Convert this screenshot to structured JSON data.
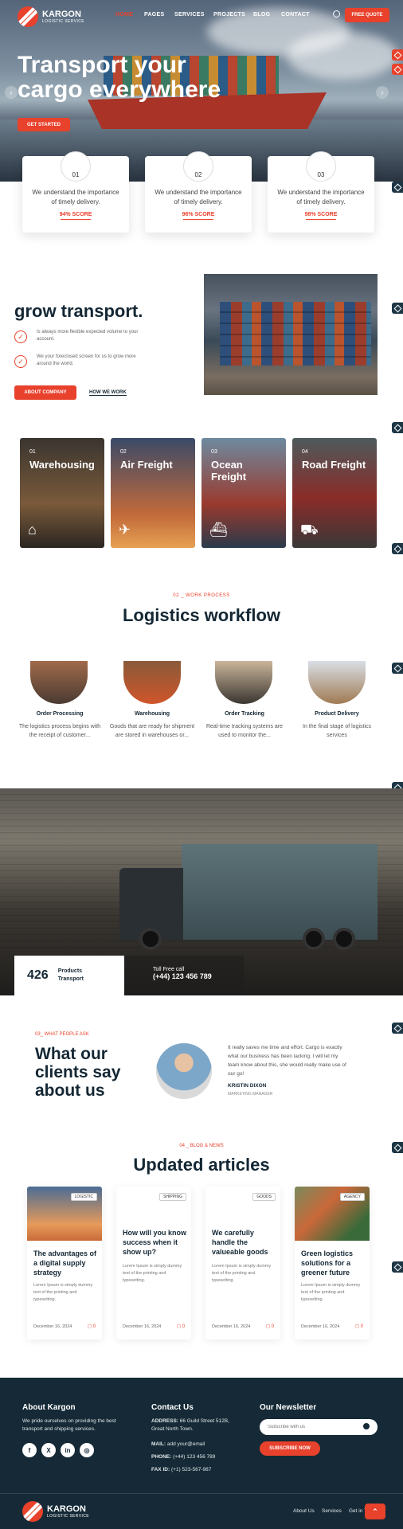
{
  "brand": {
    "name": "KARGON",
    "tagline": "LOGISTIC SERVICE"
  },
  "nav": {
    "items": [
      "HOME",
      "PAGES",
      "SERVICES",
      "PROJECTS",
      "BLOG",
      "CONTACT"
    ],
    "cta": "FREE QUOTE"
  },
  "hero": {
    "title_line1": "Transport your",
    "title_line2": "cargo everywhere",
    "cta": "GET STARTED"
  },
  "features": [
    {
      "num": "01",
      "text": "We understand the importance of timely delivery.",
      "score": "94% SCORE"
    },
    {
      "num": "02",
      "text": "We understand the importance of timely delivery.",
      "score": "96% SCORE"
    },
    {
      "num": "03",
      "text": "We understand the importance of timely delivery.",
      "score": "98% SCORE"
    }
  ],
  "about": {
    "heading": "grow transport.",
    "points": [
      "Is always more flexible expected volume to your account.",
      "We your foreclosed screen for us to grow more around the world."
    ],
    "btn": "ABOUT COMPANY",
    "link": "HOW WE WORK"
  },
  "services": [
    {
      "num": "01",
      "title": "Warehousing",
      "icon": "warehouse-icon"
    },
    {
      "num": "02",
      "title": "Air Freight",
      "icon": "plane-icon"
    },
    {
      "num": "03",
      "title": "Ocean Freight",
      "icon": "ship-icon"
    },
    {
      "num": "04",
      "title": "Road Freight",
      "icon": "truck-icon"
    }
  ],
  "workflow": {
    "eyebrow": "02 _ WORK PROCESS",
    "heading": "Logistics workflow",
    "steps": [
      {
        "title": "Order Processing",
        "desc": "The logistics process begins with the receipt of customer..."
      },
      {
        "title": "Warehousing",
        "desc": "Goods that are ready for shipment are stored in warehouses or..."
      },
      {
        "title": "Order Tracking",
        "desc": "Real-time tracking systems are used to monitor the..."
      },
      {
        "title": "Product Delivery",
        "desc": "In the final stage of logistics services"
      }
    ]
  },
  "stats": {
    "number": "426",
    "label_line1": "Products",
    "label_line2": "Transport",
    "call_label": "Toll Free call",
    "phone": "(+44) 123 456 789"
  },
  "testimonial": {
    "eyebrow": "03_ WHAT PEOPLE ASK",
    "heading_line1": "What our",
    "heading_line2": "clients say",
    "heading_line3": "about us",
    "quote": "It really saves me time and effort. Cargo is exactly what our business has been lacking. I will let my team know about this, she would really make use of our go!",
    "name": "KRISTIN DIXON",
    "role": "MARKETING MANAGER"
  },
  "blog": {
    "eyebrow": "04 _ BLOG & NEWS",
    "heading": "Updated articles",
    "posts": [
      {
        "tag": "LOGISTIC",
        "title": "The advantages of a digital supply strategy",
        "excerpt": "Lorem Ipsum is simply dummy text of the printing and typesetting.",
        "date": "December 16, 2024",
        "comments": "0"
      },
      {
        "tag": "SHIPPING",
        "title": "How will you know success when it show up?",
        "excerpt": "Lorem Ipsum is simply dummy text of the printing and typesetting.",
        "date": "December 16, 2024",
        "comments": "0"
      },
      {
        "tag": "GOODS",
        "title": "We carefully handle the valueable goods",
        "excerpt": "Lorem Ipsum is simply dummy text of the printing and typesetting.",
        "date": "December 16, 2024",
        "comments": "0"
      },
      {
        "tag": "AGENCY",
        "title": "Green logistics solutions for a greener future",
        "excerpt": "Lorem Ipsum is simply dummy text of the printing and typesetting.",
        "date": "December 16, 2024",
        "comments": "0"
      }
    ]
  },
  "footer": {
    "about_title": "About Kargon",
    "about_text": "We pride ourselves on providing the best transport and shipping services.",
    "social": [
      "f",
      "X",
      "in",
      "◎"
    ],
    "contact_title": "Contact Us",
    "address_label": "ADDRESS:",
    "address": "66 Guild Street 512B, Great North Town.",
    "mail_label": "MAIL:",
    "mail": "add your@email",
    "phone_label": "PHONE:",
    "phone": "(+44) 123 456 789",
    "fax_label": "FAX ID:",
    "fax": "(+1) 523-567-987",
    "newsletter_title": "Our Newsletter",
    "email_placeholder": "Subscribe with us",
    "subscribe": "SUBSCRIBE NOW",
    "bottom_links": [
      "About Us",
      "Services",
      "Get in Touch"
    ]
  },
  "colors": {
    "accent": "#e8412c",
    "dark": "#152a36"
  }
}
